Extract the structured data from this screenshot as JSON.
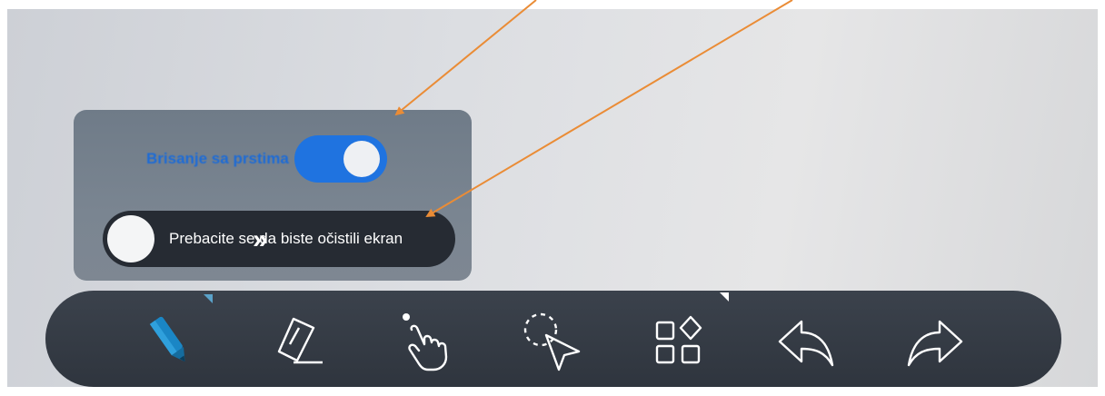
{
  "popup": {
    "eraser_label": "Brisanje sa prstima",
    "eraser_toggle_on": true,
    "clear_slider_text": "Prebacite se da biste očistili ekran",
    "clear_slider_chevrons": "»"
  },
  "toolbar": {
    "tools": [
      {
        "icon": "pen-icon",
        "active": true
      },
      {
        "icon": "eraser-icon"
      },
      {
        "icon": "hand-touch-icon"
      },
      {
        "icon": "lasso-select-icon"
      },
      {
        "icon": "apps-grid-icon"
      },
      {
        "icon": "undo-arrow-icon"
      },
      {
        "icon": "redo-arrow-icon"
      }
    ]
  },
  "colors": {
    "annotation_arrow": "#ea8c36",
    "toggle_blue": "#1f73e0",
    "toolbar_bg": "#343a43",
    "pen_blue": "#1a86c5"
  }
}
